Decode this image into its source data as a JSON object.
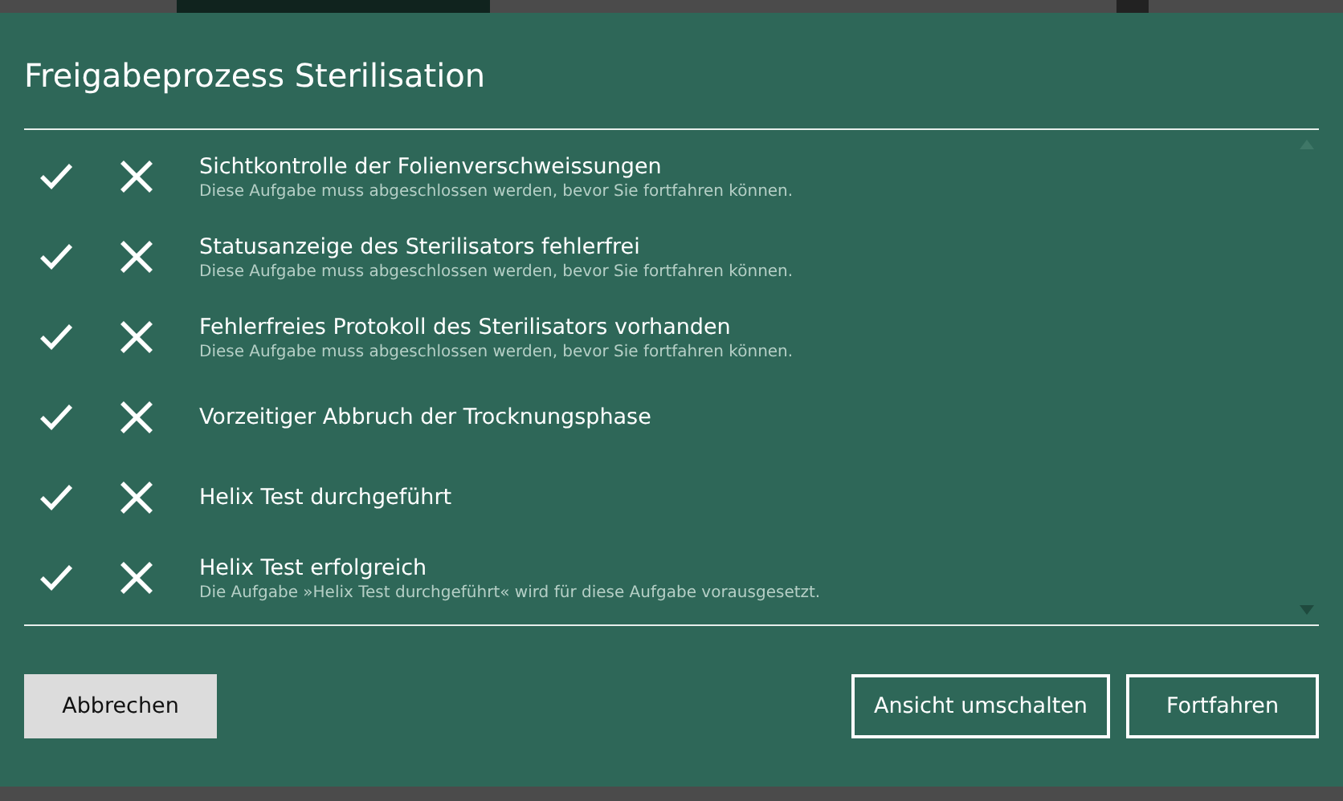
{
  "dialog": {
    "title": "Freigabeprozess Sterilisation"
  },
  "tasks": [
    {
      "title": "Sichtkontrolle der Folienverschweissungen",
      "note": "Diese Aufgabe muss abgeschlossen werden, bevor Sie fortfahren können."
    },
    {
      "title": "Statusanzeige des Sterilisators fehlerfrei",
      "note": "Diese Aufgabe muss abgeschlossen werden, bevor Sie fortfahren können."
    },
    {
      "title": "Fehlerfreies Protokoll des Sterilisators vorhanden",
      "note": "Diese Aufgabe muss abgeschlossen werden, bevor Sie fortfahren können."
    },
    {
      "title": "Vorzeitiger Abbruch der Trocknungsphase"
    },
    {
      "title": "Helix Test durchgeführt"
    },
    {
      "title": "Helix Test erfolgreich",
      "note": "Die Aufgabe »Helix Test durchgeführt« wird für diese Aufgabe vorausgesetzt."
    }
  ],
  "buttons": [
    {
      "label": "Abbrechen",
      "kind": "filled"
    },
    {
      "label": "Ansicht umschalten",
      "kind": "outline"
    },
    {
      "label": "Fortfahren",
      "kind": "outline"
    }
  ]
}
